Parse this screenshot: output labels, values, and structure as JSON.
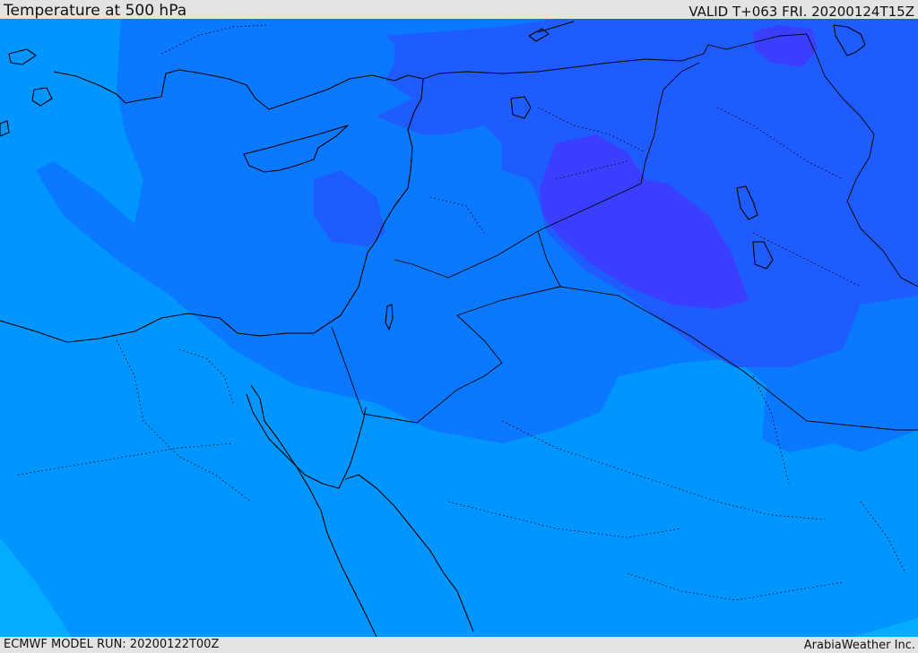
{
  "header": {
    "title": "Temperature at 500 hPa",
    "valid": "VALID T+063 FRI. 20200124T15Z"
  },
  "footer": {
    "model_run": "ECMWF MODEL RUN: 20200122T00Z",
    "credit": "ArabiaWeather Inc."
  },
  "map": {
    "field": "temperature-500hPa",
    "colors": {
      "band_lightest": "#02adff",
      "band_light": "#0095ff",
      "band_mid": "#0a78ff",
      "band_dark": "#1f5cff",
      "band_coldest": "#3a3fff",
      "coastline": "#000000",
      "borders": "#000000"
    }
  }
}
